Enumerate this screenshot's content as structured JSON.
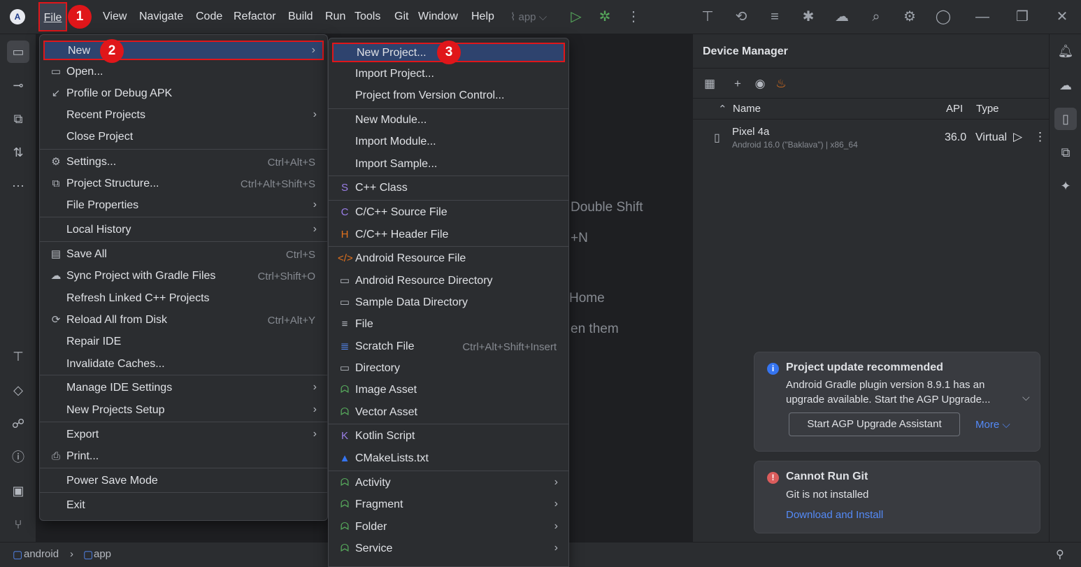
{
  "menubar": {
    "items": [
      "File",
      "View",
      "Navigate",
      "Code",
      "Refactor",
      "Build",
      "Run",
      "Tools",
      "Git",
      "Window",
      "Help"
    ],
    "run_config": "app"
  },
  "markers": [
    "1",
    "2",
    "3"
  ],
  "file_menu": {
    "items": [
      {
        "label": "New",
        "icon": "",
        "shortcut": "",
        "submenu": true
      },
      {
        "label": "Open...",
        "icon": "folder-icon",
        "shortcut": "",
        "submenu": false
      },
      {
        "label": "Profile or Debug APK",
        "icon": "apk-icon",
        "shortcut": "",
        "submenu": false
      },
      {
        "label": "Recent Projects",
        "icon": "",
        "shortcut": "",
        "submenu": true
      },
      {
        "label": "Close Project",
        "icon": "",
        "shortcut": "",
        "submenu": false
      },
      {
        "label": "Settings...",
        "icon": "gear-icon",
        "shortcut": "Ctrl+Alt+S",
        "submenu": false
      },
      {
        "label": "Project Structure...",
        "icon": "project-structure-icon",
        "shortcut": "Ctrl+Alt+Shift+S",
        "submenu": false
      },
      {
        "label": "File Properties",
        "icon": "",
        "shortcut": "",
        "submenu": true
      },
      {
        "label": "Local History",
        "icon": "",
        "shortcut": "",
        "submenu": true
      },
      {
        "label": "Save All",
        "icon": "save-icon",
        "shortcut": "Ctrl+S",
        "submenu": false
      },
      {
        "label": "Sync Project with Gradle Files",
        "icon": "gradle-sync-icon",
        "shortcut": "Ctrl+Shift+O",
        "submenu": false
      },
      {
        "label": "Refresh Linked C++ Projects",
        "icon": "",
        "shortcut": "",
        "submenu": false
      },
      {
        "label": "Reload All from Disk",
        "icon": "reload-icon",
        "shortcut": "Ctrl+Alt+Y",
        "submenu": false
      },
      {
        "label": "Repair IDE",
        "icon": "",
        "shortcut": "",
        "submenu": false
      },
      {
        "label": "Invalidate Caches...",
        "icon": "",
        "shortcut": "",
        "submenu": false
      },
      {
        "label": "Manage IDE Settings",
        "icon": "",
        "shortcut": "",
        "submenu": true
      },
      {
        "label": "New Projects Setup",
        "icon": "",
        "shortcut": "",
        "submenu": true
      },
      {
        "label": "Export",
        "icon": "",
        "shortcut": "",
        "submenu": true
      },
      {
        "label": "Print...",
        "icon": "print-icon",
        "shortcut": "",
        "submenu": false
      },
      {
        "label": "Power Save Mode",
        "icon": "",
        "shortcut": "",
        "submenu": false
      },
      {
        "label": "Exit",
        "icon": "",
        "shortcut": "",
        "submenu": false
      }
    ]
  },
  "new_menu": {
    "items": [
      {
        "label": "New Project...",
        "icon": "",
        "shortcut": "",
        "submenu": false
      },
      {
        "label": "Import Project...",
        "icon": "",
        "shortcut": "",
        "submenu": false
      },
      {
        "label": "Project from Version Control...",
        "icon": "",
        "shortcut": "",
        "submenu": false
      },
      {
        "label": "New Module...",
        "icon": "",
        "shortcut": "",
        "submenu": false
      },
      {
        "label": "Import Module...",
        "icon": "",
        "shortcut": "",
        "submenu": false
      },
      {
        "label": "Import Sample...",
        "icon": "",
        "shortcut": "",
        "submenu": false
      },
      {
        "label": "C++ Class",
        "icon": "cpp-class-icon",
        "shortcut": "",
        "submenu": false
      },
      {
        "label": "C/C++ Source File",
        "icon": "cpp-source-icon",
        "shortcut": "",
        "submenu": false
      },
      {
        "label": "C/C++ Header File",
        "icon": "cpp-header-icon",
        "shortcut": "",
        "submenu": false
      },
      {
        "label": "Android Resource File",
        "icon": "xml-icon",
        "shortcut": "",
        "submenu": false
      },
      {
        "label": "Android Resource Directory",
        "icon": "folder-icon",
        "shortcut": "",
        "submenu": false
      },
      {
        "label": "Sample Data Directory",
        "icon": "folder-icon",
        "shortcut": "",
        "submenu": false
      },
      {
        "label": "File",
        "icon": "file-icon",
        "shortcut": "",
        "submenu": false
      },
      {
        "label": "Scratch File",
        "icon": "scratch-icon",
        "shortcut": "Ctrl+Alt+Shift+Insert",
        "submenu": false
      },
      {
        "label": "Directory",
        "icon": "folder-icon",
        "shortcut": "",
        "submenu": false
      },
      {
        "label": "Image Asset",
        "icon": "android-icon",
        "shortcut": "",
        "submenu": false
      },
      {
        "label": "Vector Asset",
        "icon": "android-icon",
        "shortcut": "",
        "submenu": false
      },
      {
        "label": "Kotlin Script",
        "icon": "kotlin-icon",
        "shortcut": "",
        "submenu": false
      },
      {
        "label": "CMakeLists.txt",
        "icon": "cmake-icon",
        "shortcut": "",
        "submenu": false
      },
      {
        "label": "Activity",
        "icon": "android-icon",
        "shortcut": "",
        "submenu": true
      },
      {
        "label": "Fragment",
        "icon": "android-icon",
        "shortcut": "",
        "submenu": true
      },
      {
        "label": "Folder",
        "icon": "android-icon",
        "shortcut": "",
        "submenu": true
      },
      {
        "label": "Service",
        "icon": "android-icon",
        "shortcut": "",
        "submenu": true
      }
    ]
  },
  "editor_hints": [
    "Double Shift",
    "+N",
    "Home",
    "en them"
  ],
  "device_manager": {
    "title": "Device Manager",
    "columns": [
      "Name",
      "API",
      "Type"
    ],
    "device": {
      "name": "Pixel 4a",
      "description": "Android 16.0 (\"Baklava\") | x86_64",
      "api": "36.0",
      "type": "Virtual"
    }
  },
  "notifications": {
    "update": {
      "title": "Project update recommended",
      "body": "Android Gradle plugin version 8.9.1 has an upgrade available. Start the AGP Upgrade...",
      "button": "Start AGP Upgrade Assistant",
      "more": "More"
    },
    "git": {
      "title": "Cannot Run Git",
      "body": "Git is not installed",
      "link": "Download and Install"
    }
  },
  "statusbar": {
    "breadcrumb": [
      "android",
      "app"
    ]
  },
  "colors": {
    "highlight_border": "#e0161a",
    "selection": "#2e436e",
    "link": "#548af7",
    "android_green": "#56a85b"
  }
}
